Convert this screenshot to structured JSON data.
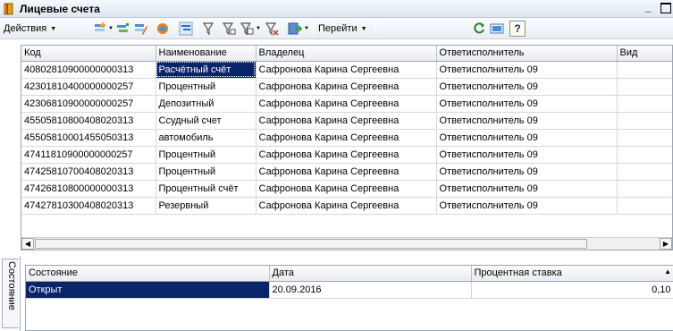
{
  "window": {
    "title": "Лицевые счета",
    "accent": "#0a246a"
  },
  "toolbar": {
    "actions_label": "Действия",
    "goto_label": "Перейти",
    "help_label": "?",
    "icons": [
      "add-icon",
      "copy-icon",
      "edit-icon",
      "delete-mark-icon",
      "hierarchy-icon",
      "filter-icon",
      "filter-options-icon",
      "filter-history-icon",
      "clear-filter-icon",
      "output-icon",
      "refresh-icon",
      "report-icon",
      "help-icon"
    ]
  },
  "grid": {
    "columns": [
      "Код",
      "Наименование",
      "Владелец",
      "Ответисполнитель",
      "Вид"
    ],
    "rows": [
      [
        "40802810900000000313",
        "Расчётный счёт",
        "Сафронова Карина Сергеевна",
        "Ответисполнитель 09",
        ""
      ],
      [
        "42301810400000000257",
        "Процентный",
        "Сафронова Карина Сергеевна",
        "Ответисполнитель 09",
        ""
      ],
      [
        "42306810900000000257",
        "Депозитный",
        "Сафронова Карина Сергеевна",
        "Ответисполнитель 09",
        ""
      ],
      [
        "45505810800408020313",
        "Ссудный счет",
        "Сафронова Карина Сергеевна",
        "Ответисполнитель 09",
        ""
      ],
      [
        "45505810001455050313",
        "автомобиль",
        "Сафронова Карина Сергеевна",
        "Ответисполнитель 09",
        ""
      ],
      [
        "47411810900000000257",
        "Процентный",
        "Сафронова Карина Сергеевна",
        "Ответисполнитель 09",
        ""
      ],
      [
        "47425810700408020313",
        "Процентный",
        "Сафронова Карина Сергеевна",
        "Ответисполнитель 09",
        ""
      ],
      [
        "47426810800000000313",
        "Процентный счёт",
        "Сафронова Карина Сергеевна",
        "Ответисполнитель 09",
        ""
      ],
      [
        "47427810300408020313",
        "Резервный",
        "Сафронова Карина Сергеевна",
        "Ответисполнитель 09",
        ""
      ]
    ],
    "selected_row": 0
  },
  "status_panel": {
    "tab_label": "Состояние",
    "columns": [
      "Состояние",
      "Дата",
      "Процентная ставка"
    ],
    "rows": [
      [
        "Открыт",
        "20.09.2016",
        "0,10"
      ]
    ]
  }
}
